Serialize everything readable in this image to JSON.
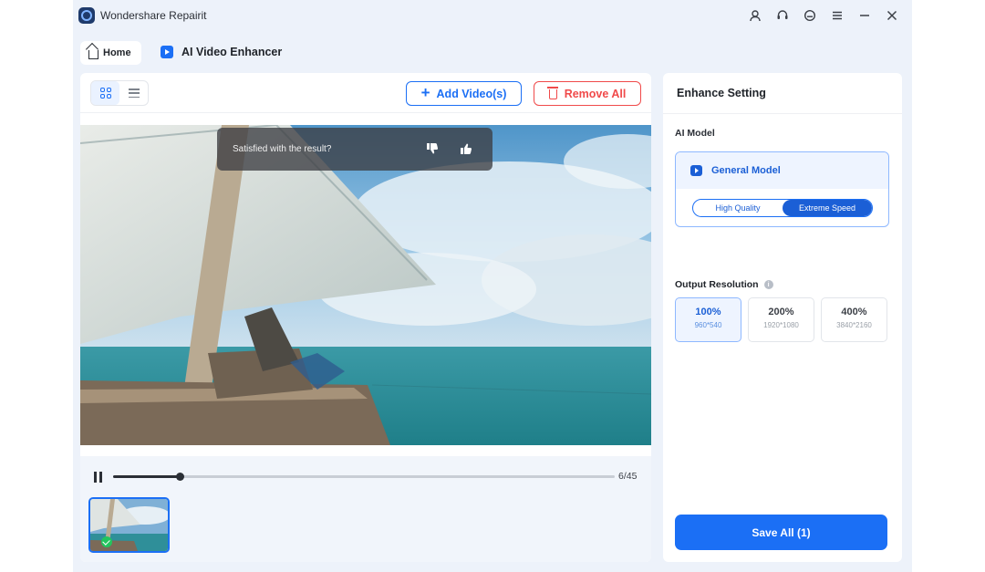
{
  "window": {
    "title": "Wondershare Repairit",
    "icons": [
      "account-icon",
      "support-icon",
      "feedback-icon",
      "menu-icon",
      "minimize-icon",
      "close-icon"
    ]
  },
  "tabs": {
    "home_label": "Home",
    "tool_label": "AI Video Enhancer"
  },
  "toolbar": {
    "add_label": "Add Video(s)",
    "remove_label": "Remove All"
  },
  "player": {
    "feedback_prompt": "Satisfied with the result?",
    "time": "6/45",
    "progress_fraction": 0.133
  },
  "settings": {
    "title": "Enhance Setting",
    "model_label": "AI Model",
    "model_name": "General Model",
    "mode_options": [
      "High Quality",
      "Extreme Speed"
    ],
    "mode_selected": "Extreme Speed",
    "resolution_label": "Output Resolution",
    "resolutions": [
      {
        "pct": "100%",
        "dims": "960*540",
        "selected": true
      },
      {
        "pct": "200%",
        "dims": "1920*1080",
        "selected": false
      },
      {
        "pct": "400%",
        "dims": "3840*2160",
        "selected": false
      }
    ],
    "save_label": "Save All (1)"
  },
  "colors": {
    "accent": "#1b6ff5",
    "danger": "#f04a4a",
    "app_bg": "#edf2fa"
  }
}
